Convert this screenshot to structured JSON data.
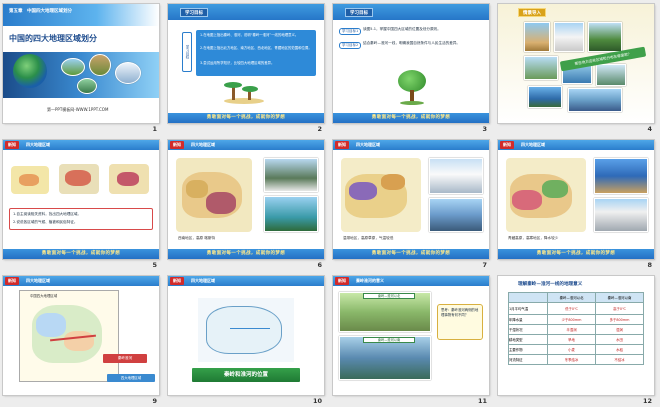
{
  "slides": [
    {
      "number": "1",
      "chapter": "第五章　中国四大地理区域划分",
      "title": "中国的四大地理区域划分",
      "footer": "第一PPT模板网-WWW.1PPT.COM"
    },
    {
      "number": "2",
      "header": "学习目标",
      "side": "学习目标",
      "lines": [
        "1.在地图上指出秦岭、淮河，说明“秦岭一淮河”一线的地理意义。",
        "2.在地图上指出北方地区、南方地区、西北地区、青藏地区的范围和位置。",
        "3.尝试运用所学知识，比较四大地理区域的差异。"
      ]
    },
    {
      "number": "3",
      "header": "学习目标",
      "items": [
        {
          "label": "学习目标1",
          "text": "读图5-1，掌握中国四大区域的位置及划分原则。"
        },
        {
          "label": "学习目标2",
          "text": "结合秦岭—淮河一线，明确我国自然条件与人民生活的差异。"
        }
      ]
    },
    {
      "number": "4",
      "header": "情景导入",
      "banner": "那些地方这些区域和分布在哪里呢？"
    },
    {
      "number": "5",
      "header": "四大地理区域",
      "bullets": [
        "1.自主阅读相关资料，找出四大地理区域。",
        "2.说说各区域的气候、植被和民俗特征。"
      ]
    },
    {
      "number": "6",
      "header": "四大地理区域",
      "caption": "西南地区，高原 喀斯特"
    },
    {
      "number": "7",
      "header": "四大地理区域",
      "caption": "温带地区，高原草原，气温较低"
    },
    {
      "number": "8",
      "header": "四大地理区域",
      "caption": "青藏高原，高寒地区，降水较少"
    },
    {
      "number": "9",
      "header": "四大地理区域",
      "mapTitle": "中国四大地理区域",
      "badge1": "秦岭淮河",
      "badge2": "四大地理区域"
    },
    {
      "number": "10",
      "header": "四大地理区域",
      "caption": "秦岭和淮河的位置"
    },
    {
      "number": "11",
      "header": "秦岭淮河的意义",
      "label1": "秦岭—淮河以北",
      "label2": "秦岭—淮河以南",
      "note": "思考：秦岭淮河两侧的地理事物有何不同？"
    },
    {
      "number": "12",
      "title": "理解秦岭—淮河一线的地理意义",
      "cols": [
        "",
        "秦岭—淮河以北",
        "秦岭—淮河以南"
      ],
      "rows": [
        [
          "1月平均气温",
          "低于0℃",
          "高于0℃"
        ],
        [
          "年降水量",
          "少于800mm",
          "多于800mm"
        ],
        [
          "干湿状况",
          "半湿润",
          "湿润"
        ],
        [
          "耕地类型",
          "旱地",
          "水田"
        ],
        [
          "主要作物",
          "小麦",
          "水稻"
        ],
        [
          "河流特征",
          "冬季结冰",
          "不结冰"
        ]
      ]
    }
  ],
  "footerSlogan": "勇敢面对每一个挑战，成就你的梦想"
}
